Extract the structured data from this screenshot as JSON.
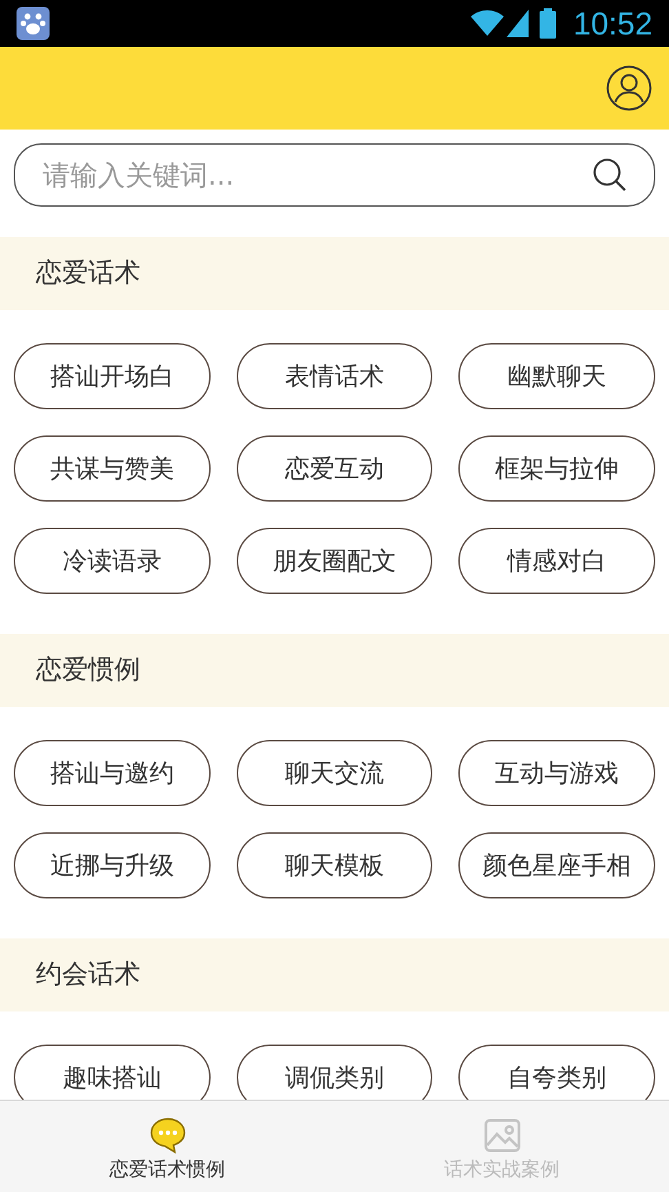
{
  "status_bar": {
    "time": "10:52"
  },
  "search": {
    "placeholder": "请输入关键词..."
  },
  "sections": [
    {
      "title": "恋爱话术",
      "tags": [
        "搭讪开场白",
        "表情话术",
        "幽默聊天",
        "共谋与赞美",
        "恋爱互动",
        "框架与拉伸",
        "冷读语录",
        "朋友圈配文",
        "情感对白"
      ]
    },
    {
      "title": "恋爱惯例",
      "tags": [
        "搭讪与邀约",
        "聊天交流",
        "互动与游戏",
        "近挪与升级",
        "聊天模板",
        "颜色星座手相"
      ]
    },
    {
      "title": "约会话术",
      "tags": [
        "趣味搭讪",
        "调侃类别",
        "自夸类别"
      ]
    }
  ],
  "bottom_nav": [
    {
      "label": "恋爱话术惯例",
      "kind": "chat",
      "selected": true
    },
    {
      "label": "话术实战案例",
      "kind": "image",
      "selected": false
    }
  ]
}
